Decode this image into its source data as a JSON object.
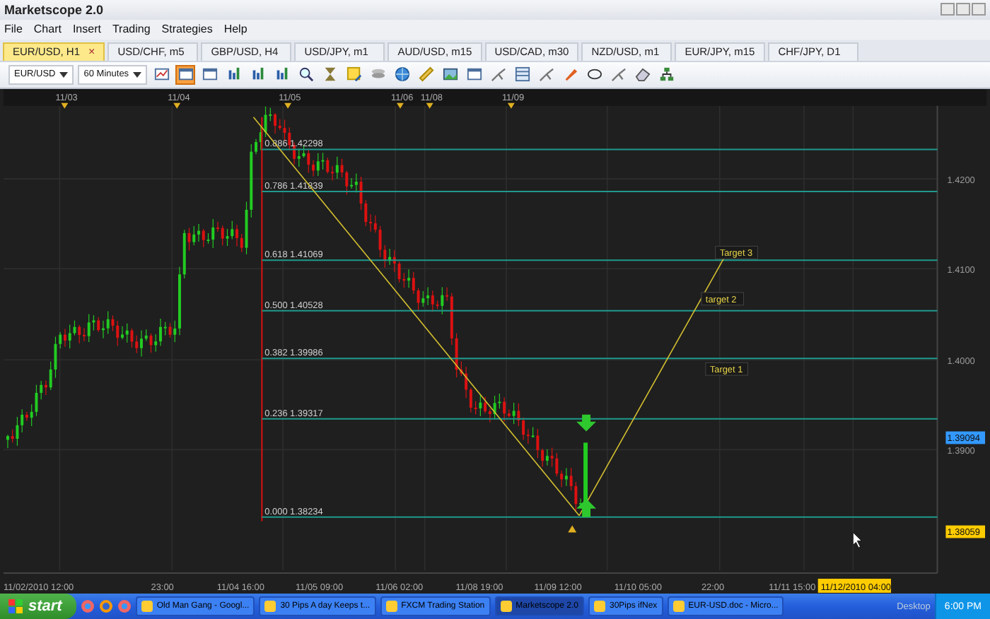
{
  "window": {
    "title": "Marketscope 2.0"
  },
  "menu": [
    "File",
    "Chart",
    "Insert",
    "Trading",
    "Strategies",
    "Help"
  ],
  "tabs": [
    {
      "label": "EUR/USD, H1",
      "selected": true,
      "close": "×"
    },
    {
      "label": "USD/CHF, m5",
      "selected": false
    },
    {
      "label": "GBP/USD, H4",
      "selected": false
    },
    {
      "label": "USD/JPY, m1",
      "selected": false
    },
    {
      "label": "AUD/USD, m15",
      "selected": false
    },
    {
      "label": "USD/CAD, m30",
      "selected": false
    },
    {
      "label": "NZD/USD, m1",
      "selected": false
    },
    {
      "label": "EUR/JPY, m15",
      "selected": false
    },
    {
      "label": "CHF/JPY, D1",
      "selected": false
    }
  ],
  "toolbar": {
    "symbol": "EUR/USD",
    "timeframe": "60 Minutes",
    "tools": [
      {
        "kind": "chart",
        "selected": false
      },
      {
        "kind": "window",
        "selected": true
      },
      {
        "kind": "window",
        "selected": false
      },
      {
        "kind": "bars",
        "selected": false
      },
      {
        "kind": "bars",
        "selected": false
      },
      {
        "kind": "bars",
        "selected": false
      },
      {
        "kind": "zoom",
        "selected": false
      },
      {
        "kind": "hourglass",
        "selected": false
      },
      {
        "kind": "note",
        "selected": false
      },
      {
        "kind": "layers",
        "selected": false
      },
      {
        "kind": "globe",
        "selected": false
      },
      {
        "kind": "ruler",
        "selected": false
      },
      {
        "kind": "picture",
        "selected": false
      },
      {
        "kind": "window",
        "selected": false
      },
      {
        "kind": "tool",
        "selected": false
      },
      {
        "kind": "grid",
        "selected": false
      },
      {
        "kind": "tool",
        "selected": false
      },
      {
        "kind": "pencil",
        "selected": false
      },
      {
        "kind": "ellipse",
        "selected": false
      },
      {
        "kind": "tool",
        "selected": false
      },
      {
        "kind": "eraser",
        "selected": false
      },
      {
        "kind": "tree",
        "selected": false
      }
    ]
  },
  "chart": {
    "date_marks": [
      "11/03",
      "11/04",
      "11/05",
      "11/06",
      "11/08",
      "11/09"
    ],
    "fib_levels": [
      "0.886 1.42298",
      "0.786 1.41839",
      "0.618 1.41069",
      "0.500 1.40528",
      "0.382 1.39986",
      "0.236 1.39317",
      "0.000 1.38234"
    ],
    "targets": [
      "Target 3",
      "target 2",
      "Target 1"
    ],
    "price_ticks": [
      "1.4200",
      "1.4100",
      "1.4000",
      "1.3900"
    ],
    "badges": [
      {
        "label": "1.39094",
        "color": "#3399ff"
      },
      {
        "label": "1.38059",
        "color": "#ffcc00"
      }
    ],
    "time_labels": [
      "11/02/2010 12:00",
      "23:00",
      "11/04 16:00",
      "11/05 09:00",
      "11/06 02:00",
      "11/08 19:00",
      "11/09 12:00",
      "11/10 05:00",
      "22:00",
      "11/11 15:00"
    ],
    "time_cursor": "11/12/2010 04:00"
  },
  "taskbar": {
    "start": "start",
    "tasks": [
      {
        "label": "Old Man Gang - Googl...",
        "selected": false
      },
      {
        "label": "30 Pips A day Keeps t...",
        "selected": false
      },
      {
        "label": "FXCM Trading Station",
        "selected": false
      },
      {
        "label": "Marketscope 2.0",
        "selected": true
      },
      {
        "label": "30Pips ifNex",
        "selected": false
      },
      {
        "label": "EUR-USD.doc - Micro...",
        "selected": false
      }
    ],
    "desktop": "Desktop",
    "clock": "6:00 PM"
  }
}
